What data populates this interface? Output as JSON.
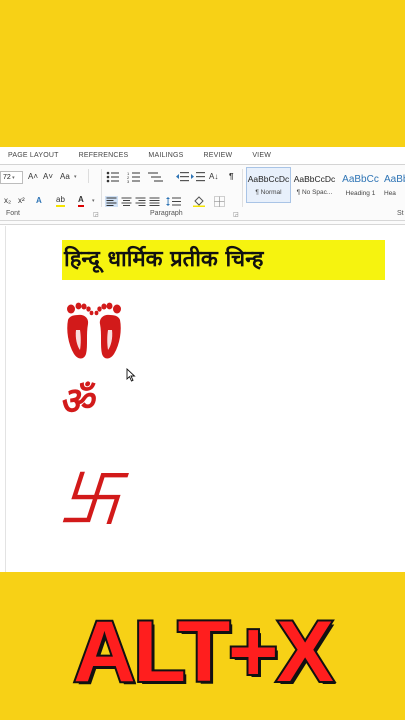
{
  "ribbon": {
    "tabs": [
      "PAGE LAYOUT",
      "REFERENCES",
      "MAILINGS",
      "REVIEW",
      "VIEW"
    ],
    "font_size_value": "72",
    "groups": {
      "font": "Font",
      "paragraph": "Paragraph",
      "styles_abbrev": "St"
    },
    "styles": [
      {
        "sample": "AaBbCcDc",
        "name": "¶ Normal"
      },
      {
        "sample": "AaBbCcDc",
        "name": "¶ No Spac..."
      },
      {
        "sample": "AaBbCc",
        "name": "Heading 1"
      },
      {
        "sample": "AaBb",
        "name": "Hea"
      }
    ],
    "controls": {
      "grow_font": "A˄",
      "shrink_font": "A˅",
      "change_case": "Aa",
      "subscript": "x₂",
      "superscript": "x²",
      "text_effects": "A",
      "highlight": "ab",
      "font_color": "A",
      "show_marks": "¶",
      "sort": "A↓"
    }
  },
  "document": {
    "title": "हिन्दू धार्मिक प्रतीक चिन्ह",
    "symbols": {
      "feet_icon": "footprints-icon",
      "om": "ॐ",
      "swastika": "卐"
    }
  },
  "overlay_text": "ALT+X",
  "colors": {
    "background": "#f7d116",
    "title_highlight": "#f6f30f",
    "symbol_red": "#d21a1a",
    "overlay_red": "#ff1e1e",
    "heading_blue": "#2e74b5"
  }
}
